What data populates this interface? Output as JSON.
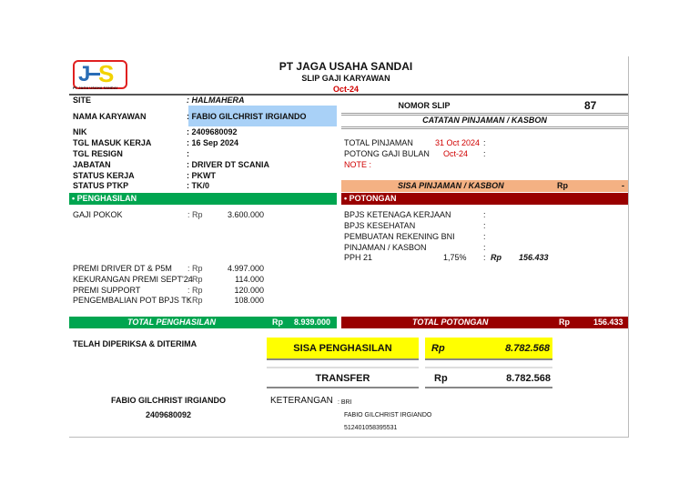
{
  "header": {
    "company": "PT JAGA USAHA SANDAI",
    "doc_title": "SLIP GAJI KARYAWAN",
    "period": "Oct-24",
    "logo_text": "JUS",
    "logo_caption": "PT JAGA USAHA SANDAI"
  },
  "employee": [
    {
      "label": "SITE",
      "value": ": HALMAHERA"
    },
    {
      "label": "NAMA KARYAWAN",
      "value": ": FABIO GILCHRIST IRGIANDO"
    },
    {
      "label": "NIK",
      "value": ": 2409680092"
    },
    {
      "label": "TGL MASUK KERJA",
      "value": ": 16 Sep 2024"
    },
    {
      "label": "TGL RESIGN",
      "value": ":"
    },
    {
      "label": "JABATAN",
      "value": ": DRIVER DT SCANIA"
    },
    {
      "label": "STATUS KERJA",
      "value": ": PKWT"
    },
    {
      "label": "STATUS PTKP",
      "value": ": TK/0"
    }
  ],
  "slip": {
    "label": "NOMOR SLIP",
    "number": "87"
  },
  "loan": {
    "title": "CATATAN PINJAMAN / KASBON",
    "total_label": "TOTAL PINJAMAN",
    "total_date": "31 Oct 2024",
    "colon": ":",
    "cut_label": "POTONG GAJI BULAN",
    "cut_month": "Oct-24",
    "note_label": "NOTE :",
    "remaining_label": "SISA PINJAMAN / KASBON",
    "remaining_currency": "Rp",
    "remaining_value": "-"
  },
  "income": {
    "title": "• PENGHASILAN",
    "items": [
      {
        "label": "GAJI POKOK",
        "sep": ": Rp",
        "value": "3.600.000"
      },
      {
        "label": "PREMI DRIVER DT & P5M",
        "sep": ": Rp",
        "value": "4.997.000"
      },
      {
        "label": "KEKURANGAN PREMI SEPT'24",
        "sep": ": Rp",
        "value": "114.000"
      },
      {
        "label": "PREMI SUPPORT",
        "sep": ": Rp",
        "value": "120.000"
      },
      {
        "label": "PENGEMBALIAN POT BPJS TK",
        "sep": ": Rp",
        "value": "108.000"
      }
    ],
    "total_label": "TOTAL PENGHASILAN",
    "total_currency": "Rp",
    "total_value": "8.939.000"
  },
  "deductions": {
    "title": "• POTONGAN",
    "items": [
      {
        "label": "BPJS KETENAGA KERJAAN",
        "rate": "",
        "sep": ":",
        "currency": "",
        "value": ""
      },
      {
        "label": "BPJS KESEHATAN",
        "rate": "",
        "sep": ":",
        "currency": "",
        "value": ""
      },
      {
        "label": "PEMBUATAN REKENING BNI",
        "rate": "",
        "sep": ":",
        "currency": "",
        "value": ""
      },
      {
        "label": "PINJAMAN / KASBON",
        "rate": "",
        "sep": ":",
        "currency": "",
        "value": ""
      },
      {
        "label": "PPH 21",
        "rate": "1,75%",
        "sep": ":",
        "currency": "Rp",
        "value": "156.433"
      }
    ],
    "total_label": "TOTAL POTONGAN",
    "total_currency": "Rp",
    "total_value": "156.433"
  },
  "summary": {
    "checked_label": "TELAH DIPERIKSA & DITERIMA",
    "net_label": "SISA PENGHASILAN",
    "net_currency": "Rp",
    "net_value": "8.782.568",
    "transfer_label": "TRANSFER",
    "transfer_currency": "Rp",
    "transfer_value": "8.782.568"
  },
  "signature": {
    "name": "FABIO GILCHRIST IRGIANDO",
    "nik": "2409680092"
  },
  "remarks": {
    "label": "KETERANGAN",
    "bank": ": BRI",
    "account_name": "FABIO GILCHRIST IRGIANDO",
    "account_number": "512401058395531"
  }
}
